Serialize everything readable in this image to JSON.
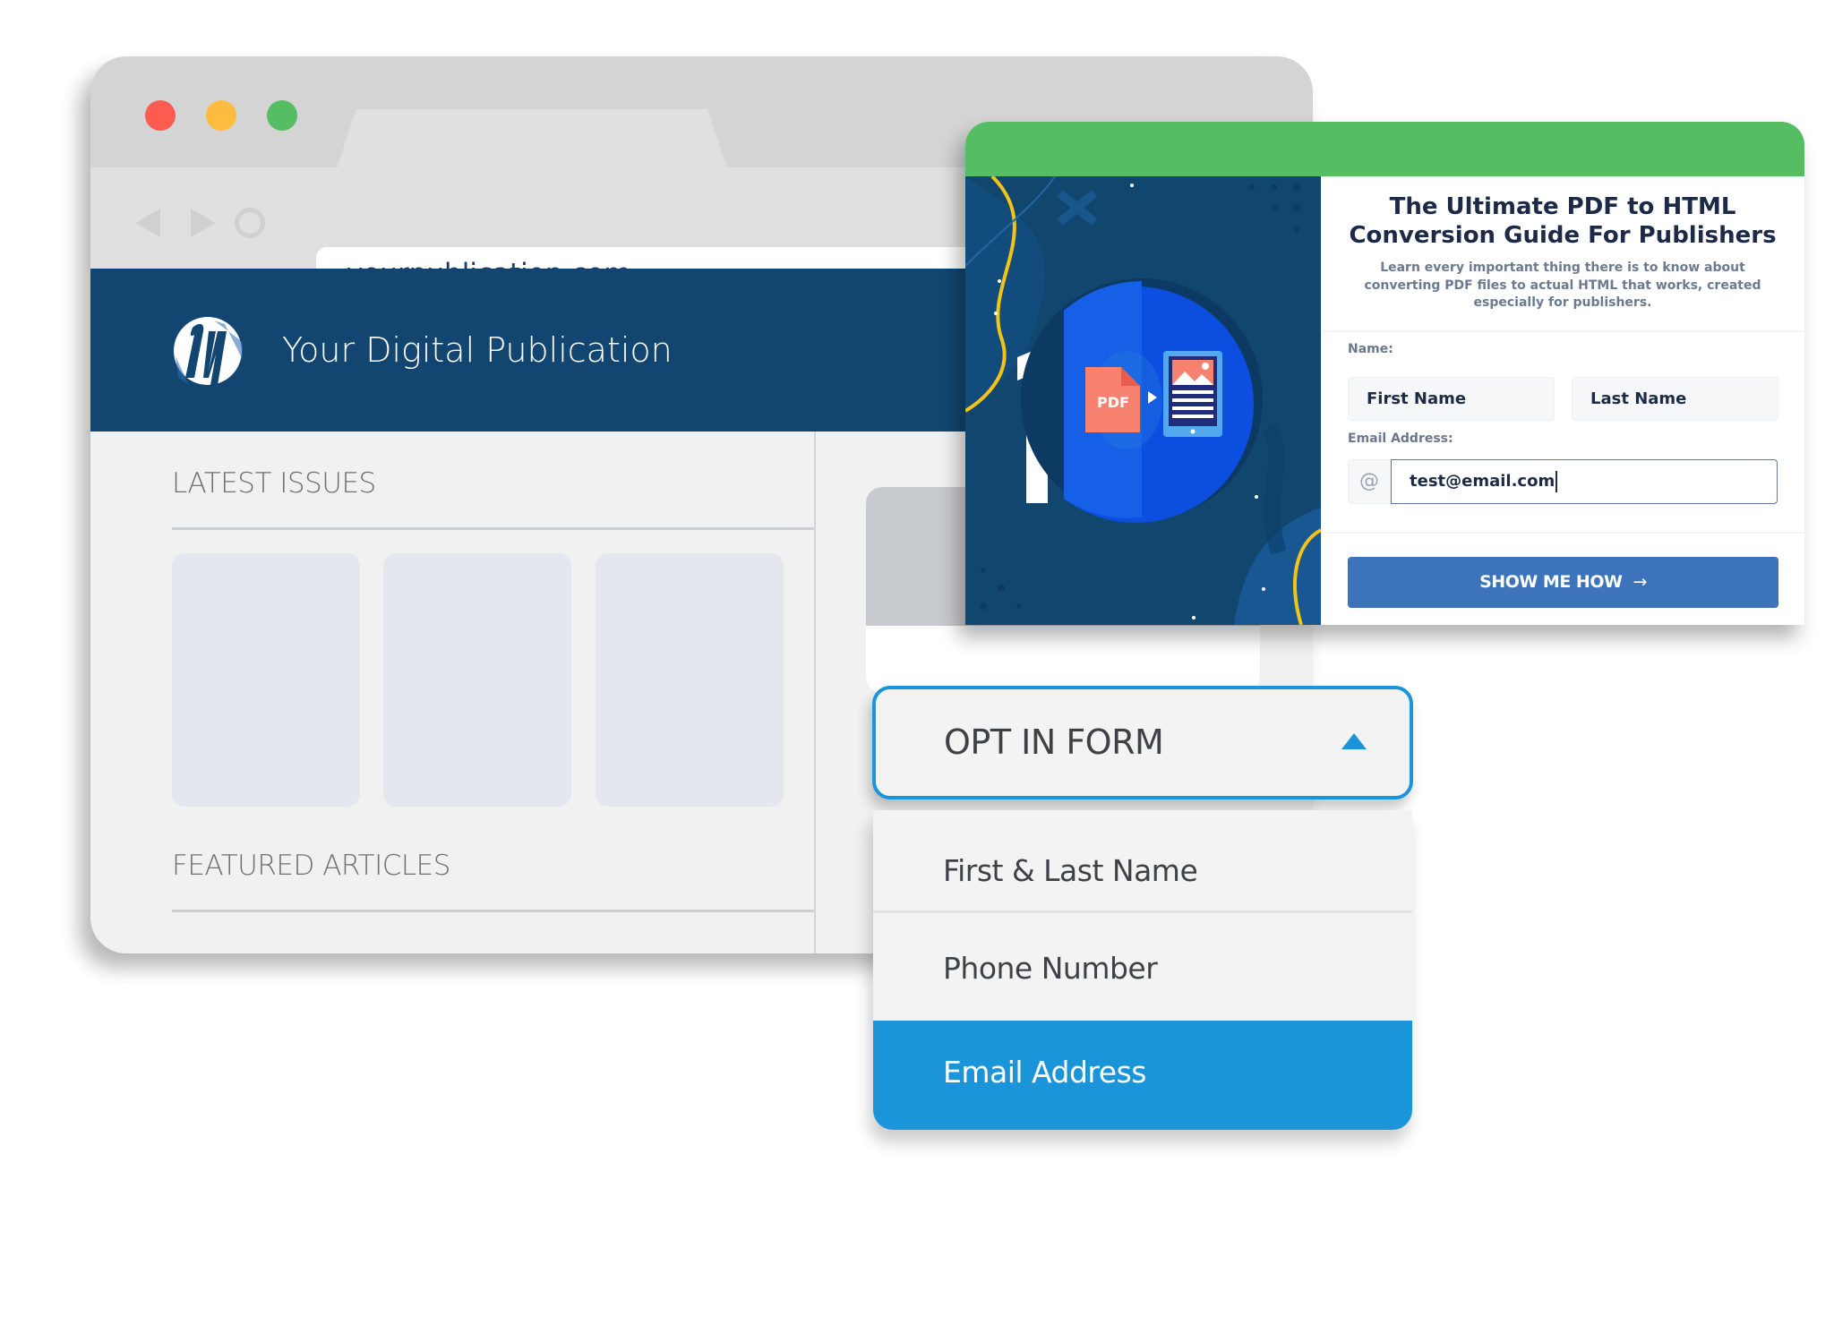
{
  "browser": {
    "window_controls": [
      "close",
      "minimize",
      "maximize"
    ],
    "nav_icons": [
      "back-icon",
      "forward-icon",
      "reload-icon"
    ],
    "address_bar": "yourpublication.com",
    "site": {
      "logo_icon": "m-logo-icon",
      "title": "Your Digital Publication"
    },
    "sections": {
      "latest_issues": "LATEST ISSUES",
      "featured_articles": "FEATURED ARTICLES"
    },
    "issue_cards_count": 3
  },
  "popup": {
    "accent_bar_color": "#57bd65",
    "art": {
      "number": "1",
      "badge_text": "PDF",
      "icons": [
        "pdf-file-icon",
        "play-arrow-icon",
        "tablet-article-icon"
      ]
    },
    "title": "The Ultimate PDF to HTML Conversion Guide For Publishers",
    "title_line1": "The Ultimate PDF to HTML",
    "title_line2": "Conversion Guide For Publishers",
    "subtitle": "Learn every important thing there is to know about converting PDF files to actual HTML that works, created especially for publishers.",
    "form": {
      "name_label": "Name:",
      "first_name_placeholder": "First Name",
      "last_name_placeholder": "Last Name",
      "email_label": "Email Address:",
      "email_icon": "@",
      "email_value": "test@email.com",
      "submit_label": "SHOW ME HOW",
      "submit_arrow": "→",
      "submit_color": "#3c73ba"
    }
  },
  "dropdown": {
    "label": "OPT IN FORM",
    "expanded": true,
    "accent_color": "#1b95da",
    "options": [
      {
        "label": "First & Last Name",
        "selected": false
      },
      {
        "label": "Phone Number",
        "selected": false
      },
      {
        "label": "Email Address",
        "selected": true
      }
    ]
  }
}
